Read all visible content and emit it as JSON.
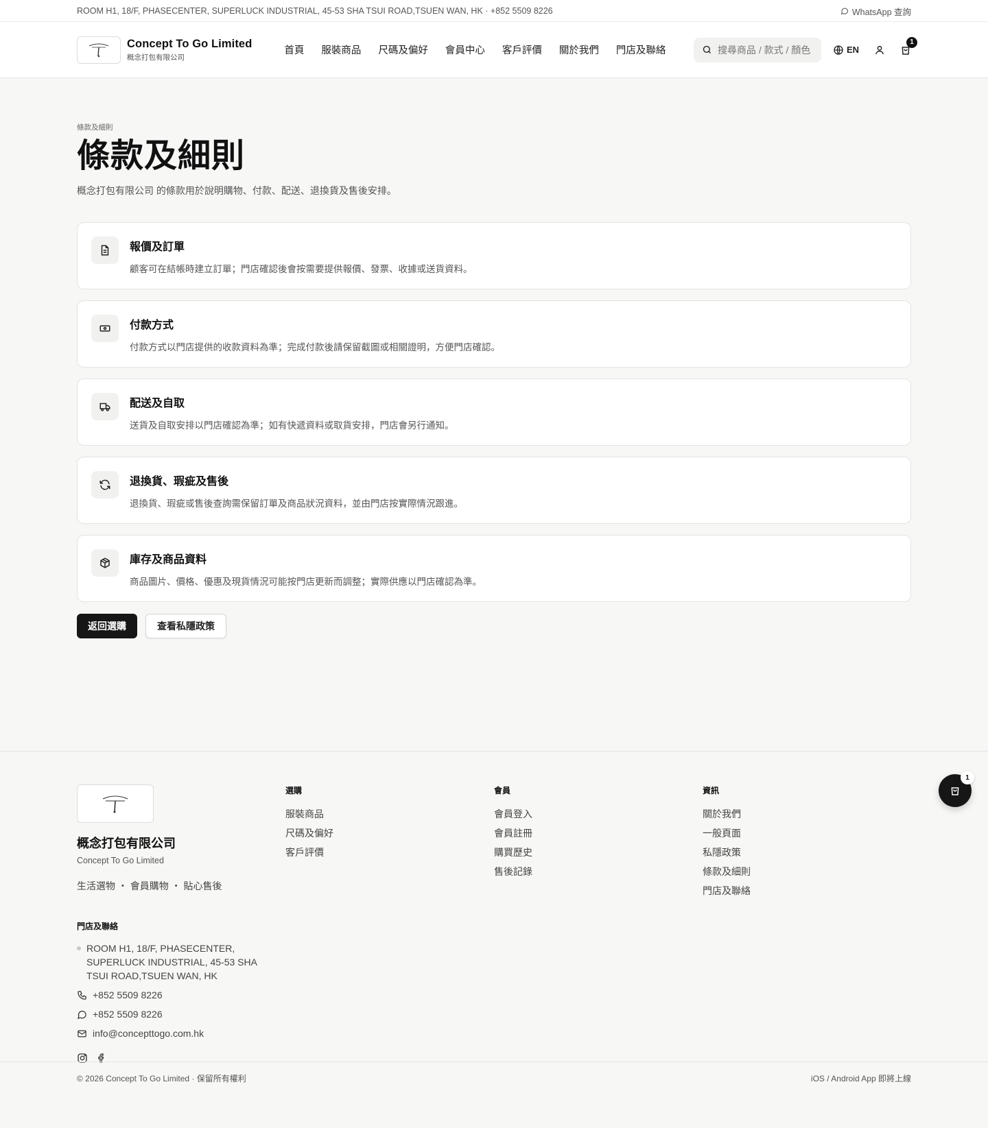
{
  "topbar": {
    "address_line": "ROOM H1, 18/F, PHASECENTER, SUPERLUCK INDUSTRIAL, 45-53 SHA TSUI ROAD,TSUEN WAN, HK · +852 5509 8226",
    "whatsapp_label": "WhatsApp 查詢"
  },
  "header": {
    "brand_en": "Concept To Go Limited",
    "brand_zh": "概念打包有限公司",
    "nav": [
      "首頁",
      "服裝商品",
      "尺碼及偏好",
      "會員中心",
      "客戶評價",
      "關於我們",
      "門店及聯絡"
    ],
    "search_placeholder": "搜尋商品 / 款式 / 顏色",
    "lang": "EN",
    "cart_count": "1"
  },
  "main": {
    "breadcrumb": "條款及細則",
    "title": "條款及細則",
    "description": "概念打包有限公司 的條款用於說明購物、付款、配送、退換貨及售後安排。",
    "cards": [
      {
        "icon": "document-icon",
        "title": "報價及訂單",
        "text": "顧客可在結帳時建立訂單；門店確認後會按需要提供報價、發票、收據或送貨資料。"
      },
      {
        "icon": "banknote-icon",
        "title": "付款方式",
        "text": "付款方式以門店提供的收款資料為準；完成付款後請保留截圖或相關證明，方便門店確認。"
      },
      {
        "icon": "truck-icon",
        "title": "配送及自取",
        "text": "送貨及自取安排以門店確認為準；如有快遞資料或取貨安排，門店會另行通知。"
      },
      {
        "icon": "refresh-icon",
        "title": "退換貨、瑕疵及售後",
        "text": "退換貨、瑕疵或售後查詢需保留訂單及商品狀況資料，並由門店按實際情況跟進。"
      },
      {
        "icon": "package-icon",
        "title": "庫存及商品資料",
        "text": "商品圖片、價格、優惠及現貨情況可能按門店更新而調整；實際供應以門店確認為準。"
      }
    ],
    "btn_back": "返回選購",
    "btn_privacy": "查看私隱政策"
  },
  "footer": {
    "name_zh": "概念打包有限公司",
    "name_en": "Concept To Go Limited",
    "tags": "生活選物 ・ 會員購物 ・ 貼心售後",
    "col_shop": {
      "heading": "選購",
      "links": [
        "服裝商品",
        "尺碼及偏好",
        "客戶評價"
      ]
    },
    "col_member": {
      "heading": "會員",
      "links": [
        "會員登入",
        "會員註冊",
        "購買歷史",
        "售後記錄"
      ]
    },
    "col_info": {
      "heading": "資訊",
      "links": [
        "關於我們",
        "一般頁面",
        "私隱政策",
        "條款及細則",
        "門店及聯絡"
      ]
    },
    "contact": {
      "heading": "門店及聯絡",
      "address": "ROOM H1, 18/F, PHASECENTER, SUPERLUCK INDUSTRIAL, 45-53 SHA TSUI ROAD,TSUEN WAN, HK",
      "phone": "+852 5509 8226",
      "whatsapp": "+852 5509 8226",
      "email": "info@concepttogo.com.hk"
    },
    "copyright": "© 2026 Concept To Go Limited · 保留所有權利",
    "app_note": "iOS / Android App 即將上線",
    "float_cart_count": "1"
  }
}
